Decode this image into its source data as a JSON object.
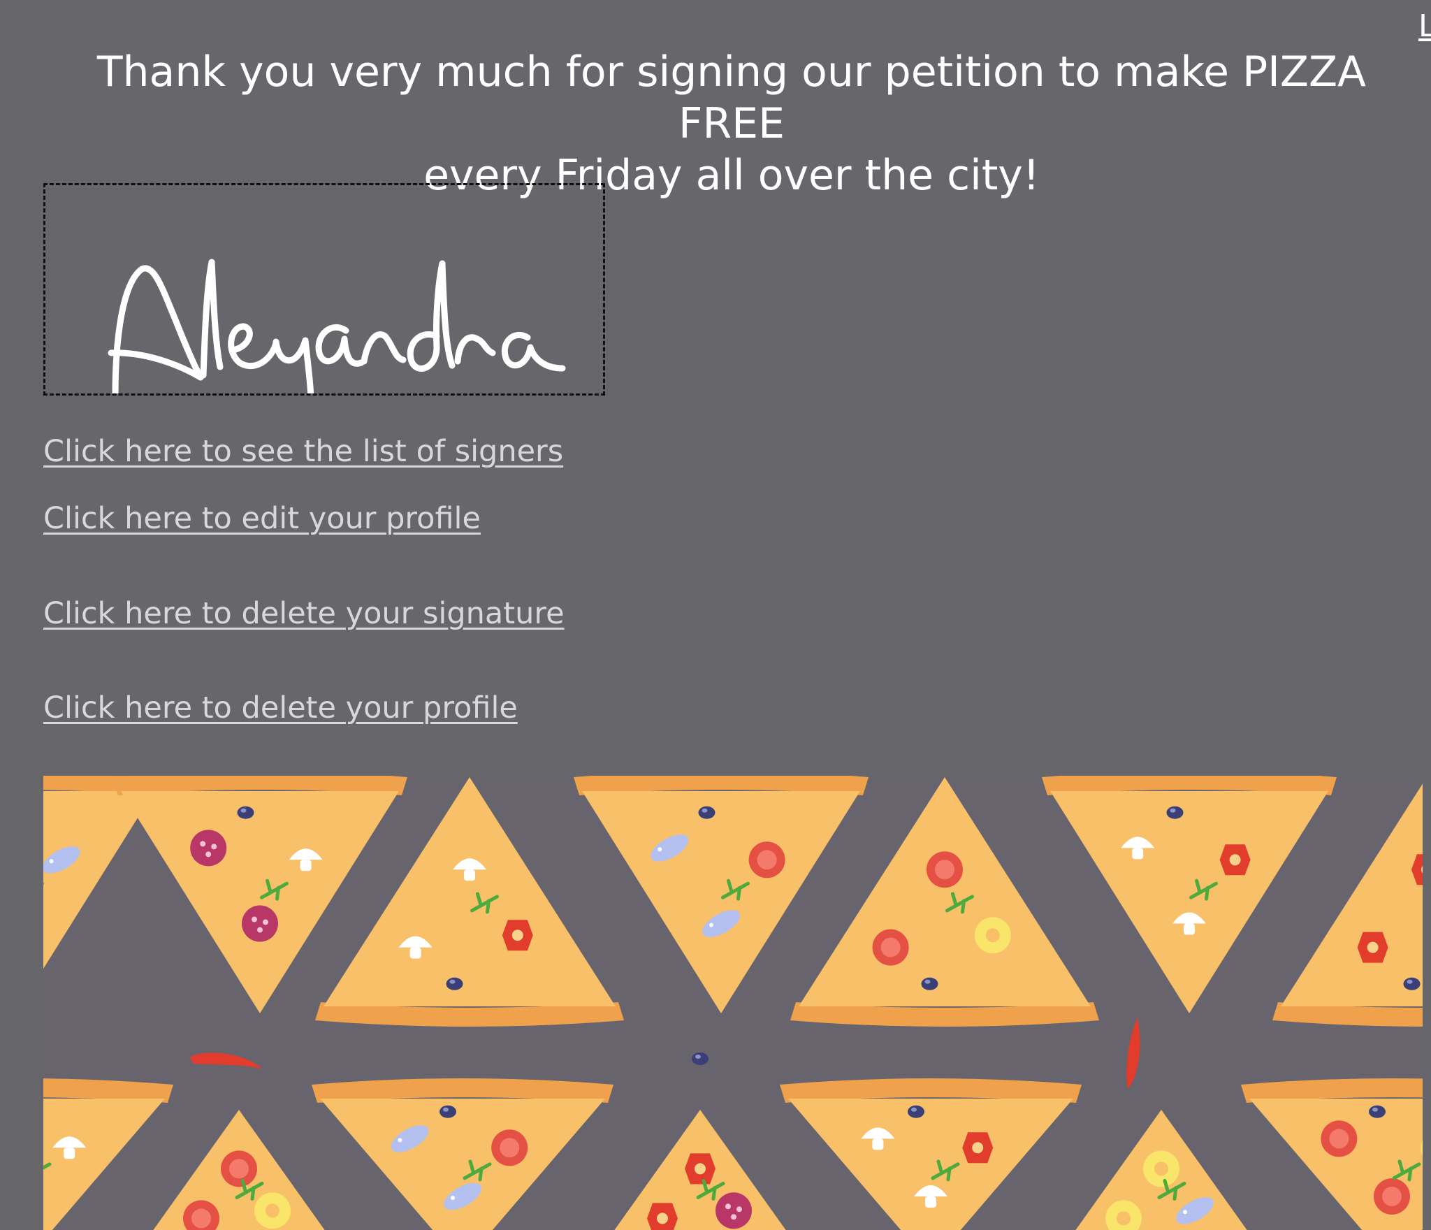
{
  "heading": {
    "line1": "Thank you very much for signing our petition to make PIZZA FREE",
    "line2": "every Friday all over the city!"
  },
  "signature": {
    "text": "Alejandra"
  },
  "corner_glyph": "L",
  "links": {
    "signers": "Click here to see the list of signers",
    "edit_profile": "Click here to edit your profile",
    "delete_signature": "Click here to delete your signature",
    "delete_profile": "Click here to delete your profile"
  },
  "banner": {
    "icon": "pizza-pattern",
    "colors": {
      "background": "#67646d",
      "crust": "#f0a14c",
      "cheese": "#f7c069",
      "pepperoni": "#b83766",
      "pineapple": "#f9e56a",
      "pepper": "#e23c2c",
      "fish": "#b4c0ef",
      "olive": "#3a3f78",
      "herb": "#4cab3c",
      "mushroom": "#ffffff",
      "tomato": "#e45044"
    }
  }
}
